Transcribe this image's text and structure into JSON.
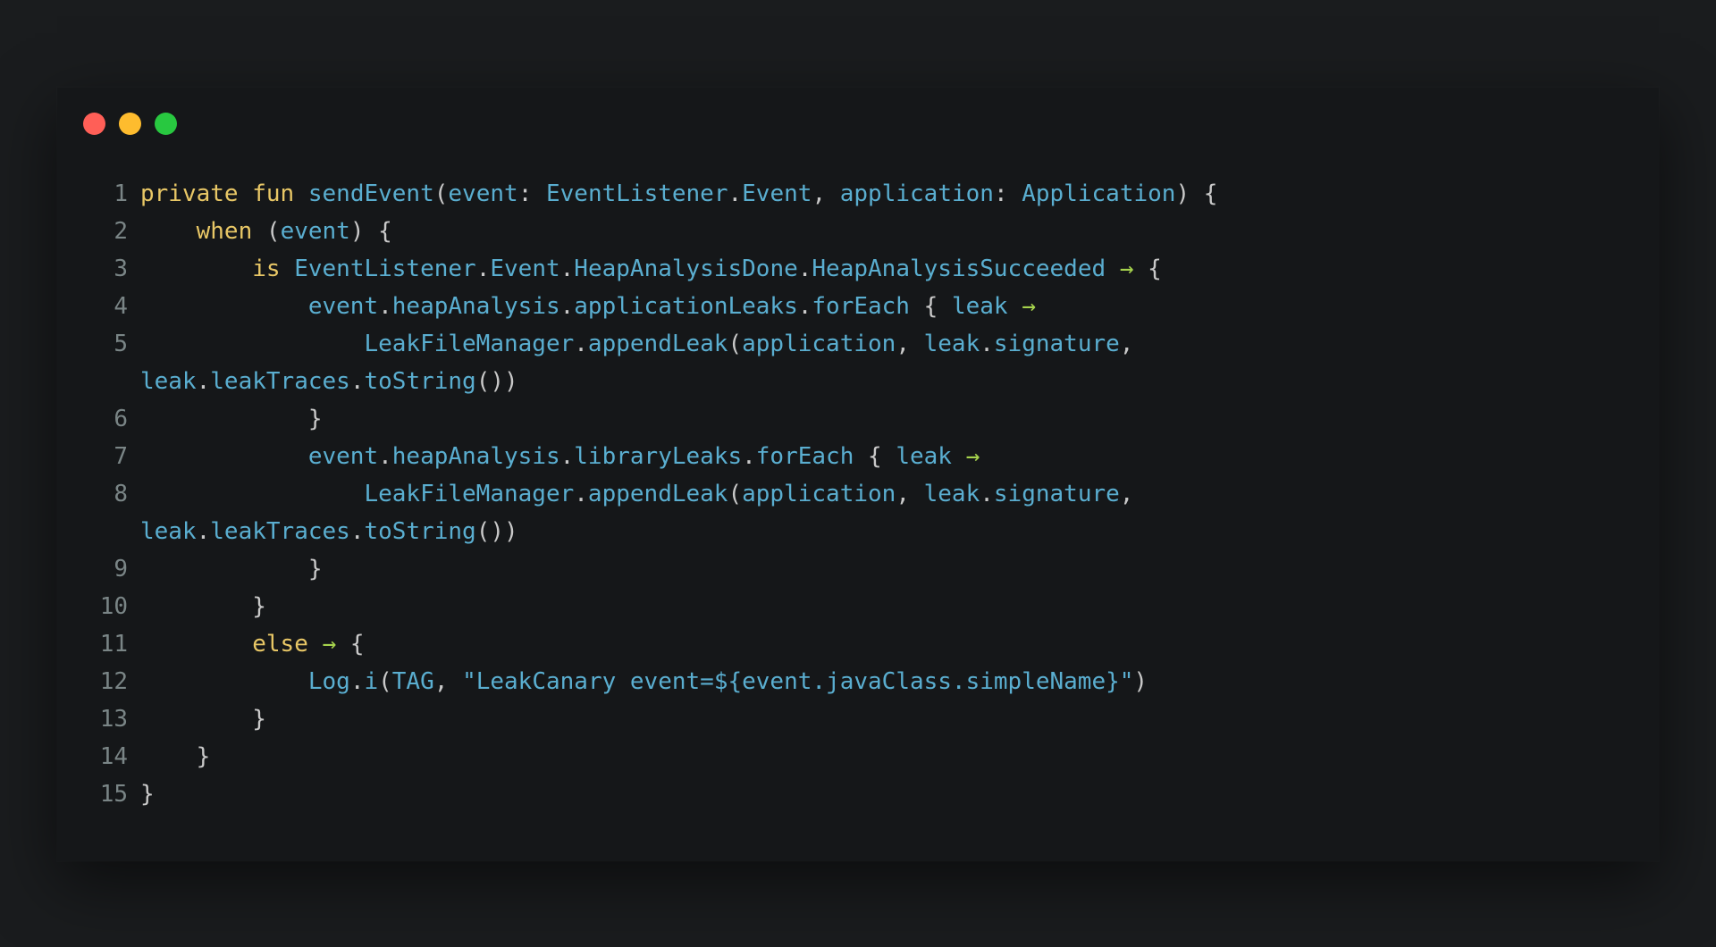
{
  "window": {
    "controls": {
      "close_color": "#ff5f57",
      "minimize_color": "#febc2e",
      "zoom_color": "#28c840"
    }
  },
  "code": {
    "language": "kotlin",
    "lines": [
      {
        "number": "1",
        "text": "private fun sendEvent(event: EventListener.Event, application: Application) {"
      },
      {
        "number": "2",
        "text": "    when (event) {"
      },
      {
        "number": "3",
        "text": "        is EventListener.Event.HeapAnalysisDone.HeapAnalysisSucceeded → {"
      },
      {
        "number": "4",
        "text": "            event.heapAnalysis.applicationLeaks.forEach { leak →"
      },
      {
        "number": "5",
        "text": "                LeakFileManager.appendLeak(application, leak.signature,"
      },
      {
        "number": "",
        "text": "leak.leakTraces.toString())"
      },
      {
        "number": "6",
        "text": "            }"
      },
      {
        "number": "7",
        "text": "            event.heapAnalysis.libraryLeaks.forEach { leak →"
      },
      {
        "number": "8",
        "text": "                LeakFileManager.appendLeak(application, leak.signature,"
      },
      {
        "number": "",
        "text": "leak.leakTraces.toString())"
      },
      {
        "number": "9",
        "text": "            }"
      },
      {
        "number": "10",
        "text": "        }"
      },
      {
        "number": "11",
        "text": "        else → {"
      },
      {
        "number": "12",
        "text": "            Log.i(TAG, \"LeakCanary event=${event.javaClass.simpleName}\")"
      },
      {
        "number": "13",
        "text": "        }"
      },
      {
        "number": "14",
        "text": "    }"
      },
      {
        "number": "15",
        "text": "}"
      }
    ]
  }
}
